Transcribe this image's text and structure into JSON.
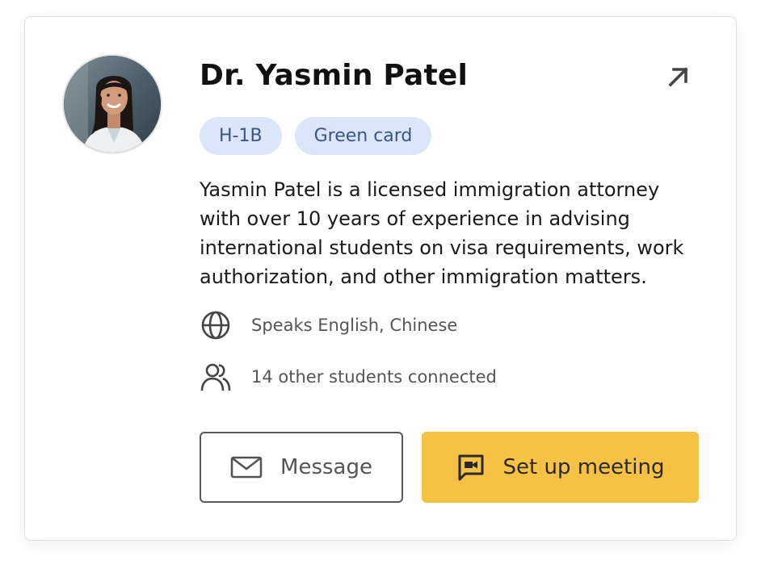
{
  "profile": {
    "name": "Dr. Yasmin Patel",
    "avatar_alt": "avatar",
    "tags": [
      {
        "label": "H-1B"
      },
      {
        "label": "Green card"
      }
    ],
    "bio": "Yasmin Patel is a licensed immigration attorney with over 10 years of experience in advising international students on visa requirements, work authorization, and other immigration matters.",
    "languages": "Speaks English, Chinese",
    "connections": "14 other students connected"
  },
  "actions": {
    "message_label": "Message",
    "meeting_label": "Set up meeting"
  },
  "icons": {
    "external": "arrow-up-right-icon",
    "languages": "globe-icon",
    "connections": "users-icon",
    "message": "envelope-icon",
    "meeting": "video-chat-icon"
  },
  "colors": {
    "tag_bg": "#dbe6fb",
    "tag_text": "#3a5489",
    "primary_button": "#f5c246",
    "border": "#e1e1e1"
  }
}
